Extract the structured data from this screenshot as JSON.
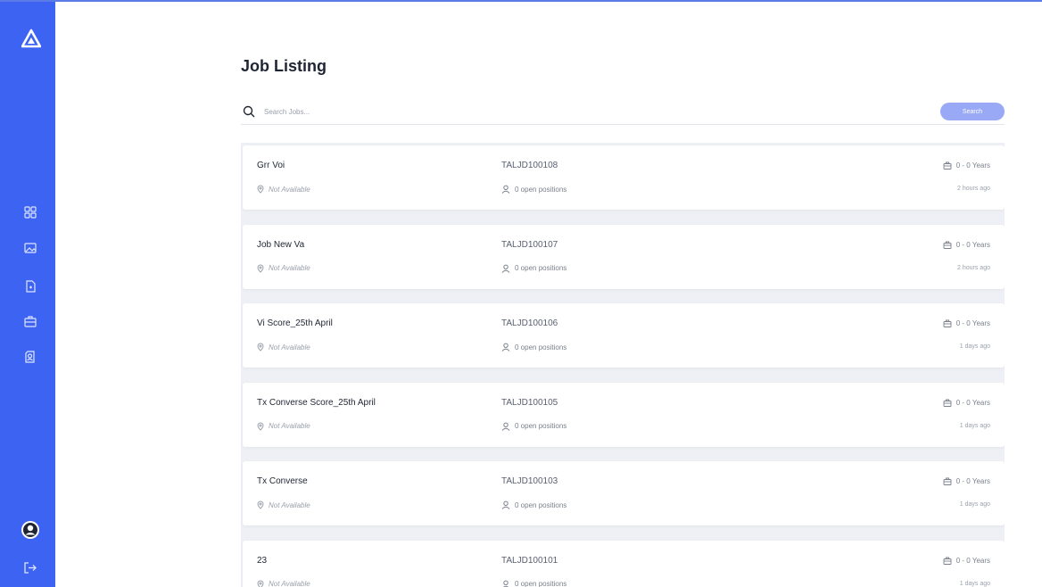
{
  "app": {
    "title": "Job Listing"
  },
  "search": {
    "placeholder": "Search Jobs...",
    "button_label": "Search"
  },
  "sidebar": {
    "logo": "triangle-logo-icon",
    "items": [
      {
        "icon": "dashboard-grid-icon"
      },
      {
        "icon": "image-gallery-icon"
      },
      {
        "icon": "document-icon"
      },
      {
        "icon": "briefcase-icon"
      },
      {
        "icon": "profile-document-icon"
      }
    ],
    "footer": [
      {
        "icon": "user-avatar-icon"
      },
      {
        "icon": "logout-icon"
      }
    ]
  },
  "jobs": [
    {
      "title": "Grr Voi",
      "location": "Not Available",
      "job_id": "TALJD100108",
      "positions": "0 open positions",
      "experience": "0 - 0 Years",
      "posted": "2 hours ago"
    },
    {
      "title": "Job New Va",
      "location": "Not Available",
      "job_id": "TALJD100107",
      "positions": "0 open positions",
      "experience": "0 - 0 Years",
      "posted": "2 hours ago"
    },
    {
      "title": "Vi Score_25th April",
      "location": "Not Available",
      "job_id": "TALJD100106",
      "positions": "0 open positions",
      "experience": "0 - 0 Years",
      "posted": "1 days ago"
    },
    {
      "title": "Tx Converse Score_25th April",
      "location": "Not Available",
      "job_id": "TALJD100105",
      "positions": "0 open positions",
      "experience": "0 - 0 Years",
      "posted": "1 days ago"
    },
    {
      "title": "Tx Converse",
      "location": "Not Available",
      "job_id": "TALJD100103",
      "positions": "0 open positions",
      "experience": "0 - 0 Years",
      "posted": "1 days ago"
    },
    {
      "title": "23",
      "location": "Not Available",
      "job_id": "TALJD100101",
      "positions": "0 open positions",
      "experience": "0 - 0 Years",
      "posted": "1 days ago"
    }
  ],
  "colors": {
    "sidebar": "#3d63f2",
    "accent_button": "#99a9f6",
    "list_bg": "#eef0f5",
    "text_primary": "#1f2533",
    "text_muted": "#9aa0ab"
  }
}
